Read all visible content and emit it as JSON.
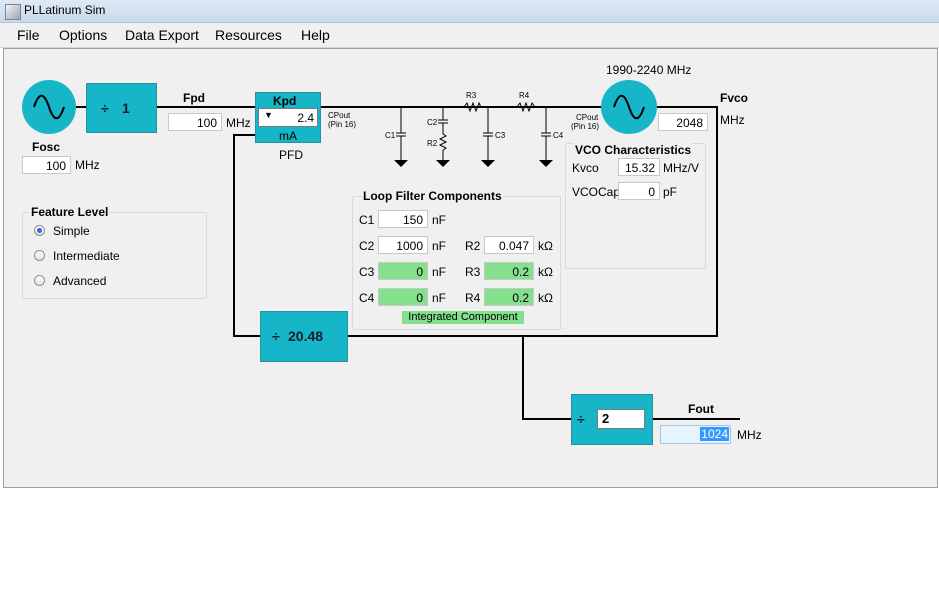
{
  "window": {
    "title": "PLLatinum Sim"
  },
  "menu": [
    "File",
    "Options",
    "Data Export",
    "Resources",
    "Help"
  ],
  "osc": {
    "label": "Fosc",
    "value": "100",
    "unit": "MHz",
    "icon": "sine-wave-icon"
  },
  "r_divider": {
    "symbol": "÷",
    "value": "1"
  },
  "fpd": {
    "label": "Fpd",
    "value": "100",
    "unit": "MHz"
  },
  "pfd": {
    "kpd_label": "Kpd",
    "kpd_value": "2.4",
    "kpd_unit": "mA",
    "label": "PFD",
    "cpout": "CPout",
    "pin": "(Pin 16)"
  },
  "filter_labels": {
    "c1": "C1",
    "c2": "C2",
    "r2": "R2",
    "r3": "R3",
    "c3": "C3",
    "r4": "R4",
    "c4": "C4"
  },
  "vco": {
    "range": "1990-2240 MHz",
    "cpout": "CPout",
    "pin": "(Pin 16)",
    "fvco_label": "Fvco",
    "fvco_value": "2048",
    "fvco_unit": "MHz"
  },
  "vco_char": {
    "title": "VCO Characteristics",
    "kvco_label": "Kvco",
    "kvco_value": "15.32",
    "kvco_unit": "MHz/V",
    "vcocap_label": "VCOCap",
    "vcocap_value": "0",
    "vcocap_unit": "pF"
  },
  "loop_filter": {
    "title": "Loop Filter Components",
    "c1": {
      "label": "C1",
      "value": "150",
      "unit": "nF"
    },
    "c2": {
      "label": "C2",
      "value": "1000",
      "unit": "nF"
    },
    "r2": {
      "label": "R2",
      "value": "0.047",
      "unit": "kΩ"
    },
    "c3": {
      "label": "C3",
      "value": "0",
      "unit": "nF"
    },
    "r3": {
      "label": "R3",
      "value": "0.2",
      "unit": "kΩ"
    },
    "c4": {
      "label": "C4",
      "value": "0",
      "unit": "nF"
    },
    "r4": {
      "label": "R4",
      "value": "0.2",
      "unit": "kΩ"
    },
    "integrated_label": "Integrated Component"
  },
  "feature_level": {
    "title": "Feature Level",
    "options": [
      "Simple",
      "Intermediate",
      "Advanced"
    ],
    "selected": "Simple"
  },
  "n_divider": {
    "symbol": "÷",
    "value": "20.48"
  },
  "out_divider": {
    "symbol": "÷",
    "value": "2"
  },
  "fout": {
    "label": "Fout",
    "value": "1024",
    "unit": "MHz"
  },
  "colors": {
    "block": "#16b5c8",
    "green_field": "#84e08c",
    "selection": "#3399ff"
  }
}
